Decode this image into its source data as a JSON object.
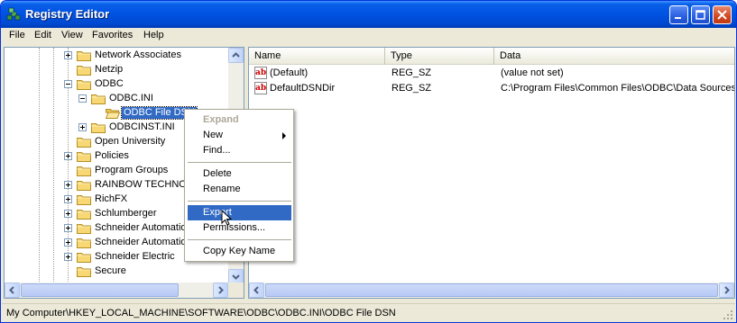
{
  "window": {
    "title": "Registry Editor"
  },
  "menubar": {
    "items": [
      "File",
      "Edit",
      "View",
      "Favorites",
      "Help"
    ]
  },
  "tree": {
    "items": [
      {
        "label": "Network Associates",
        "expander": "plus",
        "level": 0
      },
      {
        "label": "Netzip",
        "expander": "none",
        "level": 0
      },
      {
        "label": "ODBC",
        "expander": "minus",
        "level": 0
      },
      {
        "label": "ODBC.INI",
        "expander": "minus",
        "level": 1
      },
      {
        "label": "ODBC File DSN",
        "expander": "none",
        "level": 2,
        "selected": true
      },
      {
        "label": "ODBCINST.INI",
        "expander": "plus",
        "level": 1
      },
      {
        "label": "Open University",
        "expander": "none",
        "level": 0
      },
      {
        "label": "Policies",
        "expander": "plus",
        "level": 0
      },
      {
        "label": "Program Groups",
        "expander": "none",
        "level": 0
      },
      {
        "label": "RAINBOW TECHNOLOGIES",
        "expander": "plus",
        "level": 0
      },
      {
        "label": "RichFX",
        "expander": "plus",
        "level": 0
      },
      {
        "label": "Schlumberger",
        "expander": "plus",
        "level": 0
      },
      {
        "label": "Schneider Automation",
        "expander": "plus",
        "level": 0
      },
      {
        "label": "Schneider Automation",
        "expander": "plus",
        "level": 0
      },
      {
        "label": "Schneider Electric",
        "expander": "plus",
        "level": 0
      },
      {
        "label": "Secure",
        "expander": "none",
        "level": 0
      }
    ]
  },
  "list": {
    "columns": [
      "Name",
      "Type",
      "Data"
    ],
    "rows": [
      {
        "icon": "string-value-icon",
        "name": "(Default)",
        "type": "REG_SZ",
        "data": "(value not set)"
      },
      {
        "icon": "string-value-icon",
        "name": "DefaultDSNDir",
        "type": "REG_SZ",
        "data": "C:\\Program Files\\Common Files\\ODBC\\Data Sources"
      }
    ]
  },
  "context_menu": {
    "items": [
      {
        "label": "Expand",
        "style": "bold-disabled"
      },
      {
        "label": "New",
        "submenu": true
      },
      {
        "label": "Find...",
        "separator_after": true
      },
      {
        "label": "Delete"
      },
      {
        "label": "Rename",
        "separator_after": true
      },
      {
        "label": "Export",
        "highlighted": true
      },
      {
        "label": "Permissions...",
        "separator_after": true
      },
      {
        "label": "Copy Key Name"
      }
    ]
  },
  "statusbar": {
    "path": "My Computer\\HKEY_LOCAL_MACHINE\\SOFTWARE\\ODBC\\ODBC.INI\\ODBC File DSN"
  },
  "colors": {
    "selection": "#316ac5",
    "titlebar": "#0054e3",
    "close_button": "#d2451e"
  }
}
